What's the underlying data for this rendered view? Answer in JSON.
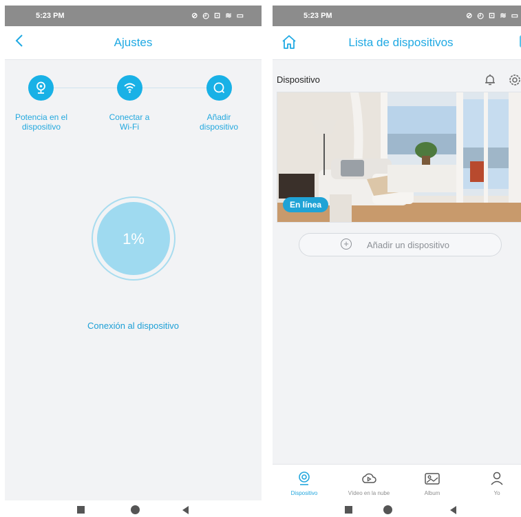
{
  "status_bar": {
    "time": "5:23 PM",
    "icons": "⊘ ◴ ⊡ ≋ ▭"
  },
  "setup": {
    "title": "Ajustes",
    "steps": [
      {
        "label_line1": "Potencia en el",
        "label_line2": "dispositivo",
        "icon": "camera-icon"
      },
      {
        "label_line1": "Conectar a",
        "label_line2": "Wi-Fi",
        "icon": "wifi-icon"
      },
      {
        "label_line1": "Añadir",
        "label_line2": "dispositivo",
        "icon": "search-icon"
      }
    ],
    "progress_text": "1%",
    "progress_value": 0.01,
    "status_text": "Conexión al dispositivo"
  },
  "device_list": {
    "title": "Lista de dispositivos",
    "section_label": "Dispositivo",
    "device_status": "En línea",
    "add_device_label": "Añadir un dispositivo",
    "nav": [
      {
        "label": "Dispositivo",
        "icon": "camera-icon",
        "active": true
      },
      {
        "label": "Vídeo en la nube",
        "icon": "cloud-play-icon",
        "active": false
      },
      {
        "label": "Album",
        "icon": "album-icon",
        "active": false
      },
      {
        "label": "Yo",
        "icon": "person-icon",
        "active": false
      }
    ]
  },
  "colors": {
    "accent": "#1fa9e3",
    "status_bar": "#8c8c8c",
    "progress": "#9fdaf0"
  }
}
